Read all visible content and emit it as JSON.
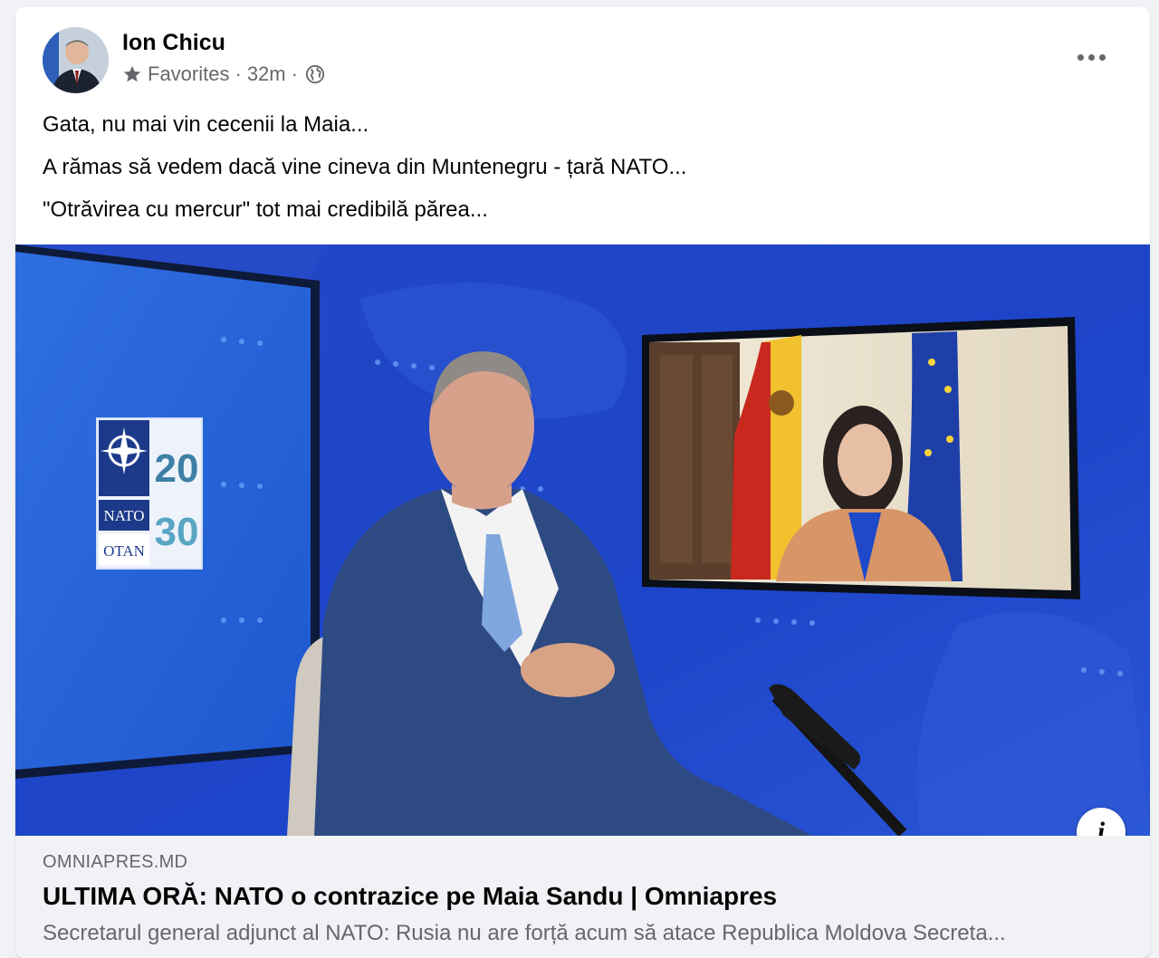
{
  "post": {
    "author": "Ion Chicu",
    "audience": "Favorites",
    "time": "32m",
    "separator": "·",
    "lines": [
      "Gata, nu mai vin cecenii la Maia...",
      "A rămas să vedem dacă vine cineva din Muntenegru - țară NATO...",
      "\"Otrăvirea cu mercur\" tot mai credibilă părea..."
    ]
  },
  "image": {
    "logo_top": "NATO",
    "logo_bottom": "OTAN",
    "logo_year_top": "20",
    "logo_year_bottom": "30"
  },
  "link": {
    "domain": "OMNIAPRES.MD",
    "title": "ULTIMA ORĂ: NATO o contrazice pe Maia Sandu | Omniapres",
    "description": "Secretarul general adjunct al NATO: Rusia nu are forță acum să atace Republica Moldova Secreta..."
  },
  "icons": {
    "star": "star-icon",
    "globe": "globe-icon",
    "more": "more-options-icon",
    "info": "info-icon"
  },
  "colors": {
    "card_bg": "#ffffff",
    "page_bg": "#f0f2f5",
    "secondary_text": "#65676b",
    "studio_blue": "#1d47c8"
  }
}
